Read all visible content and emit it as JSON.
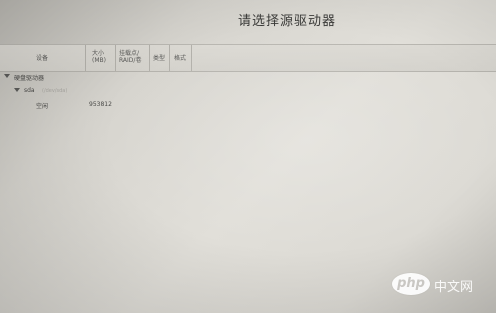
{
  "header": {
    "title": "请选择源驱动器"
  },
  "columns": {
    "device": "设备",
    "size": "大小\n(MB)",
    "mount_raid": "挂载点/\nRAID/卷",
    "boot": "类型",
    "format": "格式"
  },
  "tree": {
    "group_label": "硬盘驱动器",
    "disk_name": "sda",
    "disk_detail": "(/dev/sda)",
    "free_label": "空闲",
    "free_size": "953812"
  },
  "watermark": {
    "logo": "php",
    "site": "中文网"
  }
}
